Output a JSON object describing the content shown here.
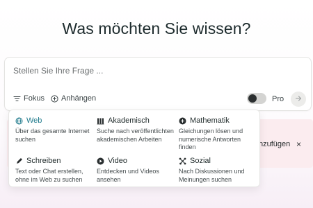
{
  "headline": "Was möchten Sie wissen?",
  "search": {
    "placeholder": "Stellen Sie Ihre Frage ...",
    "focus_label": "Fokus",
    "attach_label": "Anhängen",
    "pro_label": "Pro",
    "pro_enabled": false
  },
  "banner": {
    "text": "nzufügen",
    "close": "×"
  },
  "focus_menu": {
    "selected": "Web",
    "accent_color": "#1f7a8c",
    "options": [
      {
        "title": "Web",
        "description": "Über das gesamte Internet suchen",
        "icon": "globe-icon"
      },
      {
        "title": "Akademisch",
        "description": "Suche nach veröffentlichten akademischen Arbeiten",
        "icon": "books-icon"
      },
      {
        "title": "Mathematik",
        "description": "Gleichungen lösen und numerische Antworten finden",
        "icon": "math-icon"
      },
      {
        "title": "Schreiben",
        "description": "Text oder Chat erstellen, ohne im Web zu suchen",
        "icon": "pencil-icon"
      },
      {
        "title": "Video",
        "description": "Entdecken und Videos ansehen",
        "icon": "play-icon"
      },
      {
        "title": "Sozial",
        "description": "Nach Diskussionen und Meinungen suchen",
        "icon": "network-icon"
      }
    ]
  }
}
